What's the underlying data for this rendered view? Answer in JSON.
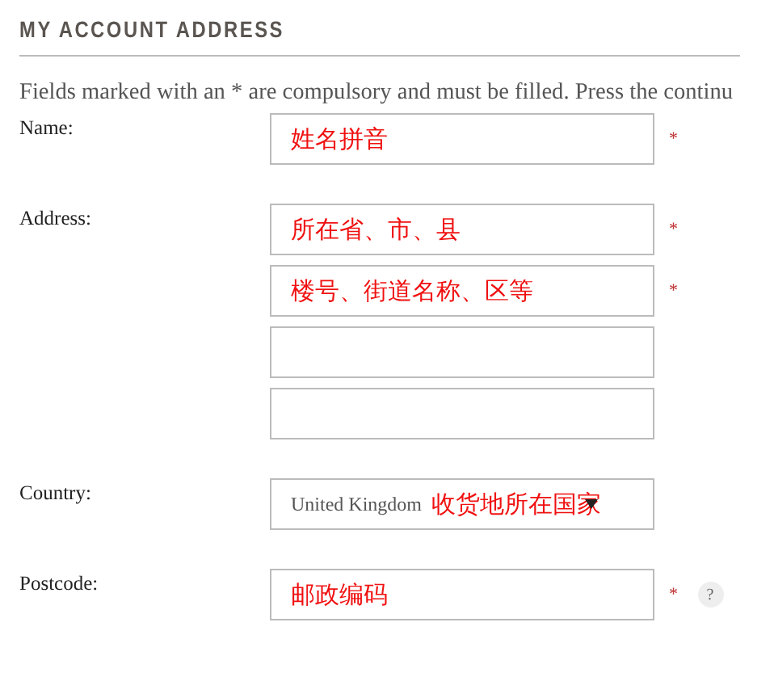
{
  "heading": "MY ACCOUNT ADDRESS",
  "notice": "Fields marked with an * are compulsory and must be filled. Press the continu",
  "rows": [
    {
      "label": "Name:",
      "fields": [
        {
          "kind": "text",
          "value": "姓名拼音",
          "required": true
        }
      ]
    },
    {
      "label": "Address:",
      "fields": [
        {
          "kind": "text",
          "value": "所在省、市、县",
          "required": true
        },
        {
          "kind": "text",
          "value": "楼号、街道名称、区等",
          "required": true
        },
        {
          "kind": "text",
          "required": false
        },
        {
          "kind": "text",
          "required": false
        }
      ]
    },
    {
      "label": "Country:",
      "fields": [
        {
          "kind": "select",
          "option": "United Kingdom",
          "value": "收货地所在国家",
          "required": false
        }
      ]
    },
    {
      "label": "Postcode:",
      "fields": [
        {
          "kind": "text",
          "value": "邮政编码",
          "required": true,
          "help": "?"
        }
      ]
    }
  ],
  "required_mark": "*"
}
